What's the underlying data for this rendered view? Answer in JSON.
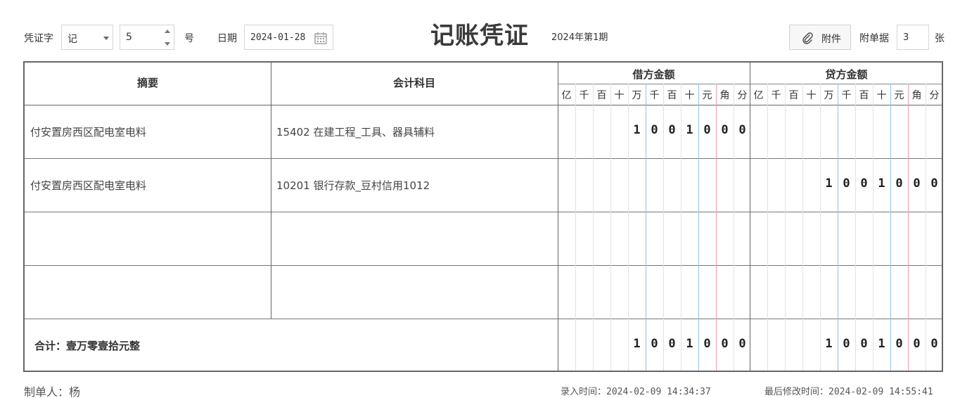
{
  "header": {
    "voucher_word_label": "凭证字",
    "voucher_word_value": "记",
    "number_value": "5",
    "number_suffix": "号",
    "date_label": "日期",
    "date_value": "2024-01-28",
    "title": "记账凭证",
    "period": "2024年第1期",
    "attach_button": "附件",
    "docs_label": "附单据",
    "docs_value": "3",
    "docs_suffix": "张"
  },
  "table": {
    "col_summary": "摘要",
    "col_account": "会计科目",
    "col_debit": "借方金额",
    "col_credit": "贷方金额",
    "digit_headers": [
      "亿",
      "千",
      "百",
      "十",
      "万",
      "千",
      "百",
      "十",
      "元",
      "角",
      "分"
    ],
    "rows": [
      {
        "summary": "付安置房西区配电室电料",
        "account": "15402 在建工程_工具、器具辅料",
        "debit": [
          "",
          "",
          "",
          "",
          "1",
          "0",
          "0",
          "1",
          "0",
          "0",
          "0"
        ],
        "credit": [
          "",
          "",
          "",
          "",
          "",
          "",
          "",
          "",
          "",
          "",
          ""
        ]
      },
      {
        "summary": "付安置房西区配电室电料",
        "account": "10201 银行存款_豆村信用1012",
        "debit": [
          "",
          "",
          "",
          "",
          "",
          "",
          "",
          "",
          "",
          "",
          ""
        ],
        "credit": [
          "",
          "",
          "",
          "",
          "1",
          "0",
          "0",
          "1",
          "0",
          "0",
          "0"
        ]
      },
      {
        "summary": "",
        "account": "",
        "debit": [
          "",
          "",
          "",
          "",
          "",
          "",
          "",
          "",
          "",
          "",
          ""
        ],
        "credit": [
          "",
          "",
          "",
          "",
          "",
          "",
          "",
          "",
          "",
          "",
          ""
        ]
      },
      {
        "summary": "",
        "account": "",
        "debit": [
          "",
          "",
          "",
          "",
          "",
          "",
          "",
          "",
          "",
          "",
          ""
        ],
        "credit": [
          "",
          "",
          "",
          "",
          "",
          "",
          "",
          "",
          "",
          "",
          ""
        ]
      }
    ],
    "total_label": "合计：壹万零壹拾元整",
    "total_debit": [
      "",
      "",
      "",
      "",
      "1",
      "0",
      "0",
      "1",
      "0",
      "0",
      "0"
    ],
    "total_credit": [
      "",
      "",
      "",
      "",
      "1",
      "0",
      "0",
      "1",
      "0",
      "0",
      "0"
    ]
  },
  "footer": {
    "maker": "制单人：杨",
    "entry_time": "录入时间：2024-02-09 14:34:37",
    "modified_time": "最后修改时间：2024-02-09 14:55:41"
  }
}
